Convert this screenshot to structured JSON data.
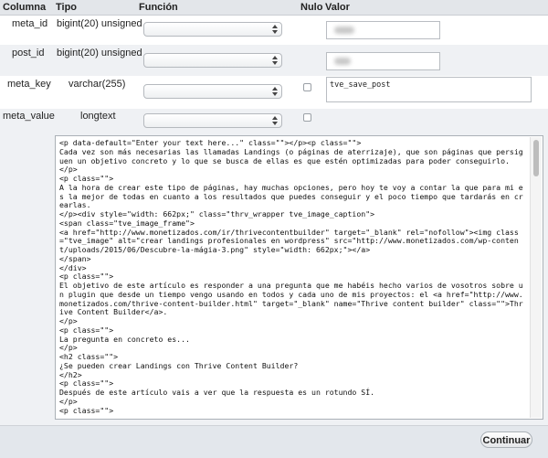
{
  "header": {
    "columna": "Columna",
    "tipo": "Tipo",
    "funcion": "Función",
    "nulo": "Nulo",
    "valor": "Valor"
  },
  "rows": [
    {
      "name": "meta_id",
      "type": "bigint(20) unsigned",
      "value": ""
    },
    {
      "name": "post_id",
      "type": "bigint(20) unsigned",
      "value": ""
    },
    {
      "name": "meta_key",
      "type": "varchar(255)",
      "value": "tve_save_post"
    },
    {
      "name": "meta_value",
      "type": "longtext",
      "value": "<p data-default=\"Enter your text here...\" class=\"\"></p><p class=\"\">\nCada vez son más necesarias las llamadas Landings (o páginas de aterrizaje), que son páginas que persiguen un objetivo concreto y lo que se busca de ellas es que estén optimizadas para poder conseguirlo.\n</p>\n<p class=\"\">\nA la hora de crear este tipo de páginas, hay muchas opciones, pero hoy te voy a contar la que para mi es la mejor de todas en cuanto a los resultados que puedes conseguir y el poco tiempo que tardarás en crearlas.\n</p><div style=\"width: 662px;\" class=\"thrv_wrapper tve_image_caption\">\n<span class=\"tve_image_frame\">\n<a href=\"http://www.monetizados.com/ir/thrivecontentbuilder\" target=\"_blank\" rel=\"nofollow\"><img class=\"tve_image\" alt=\"crear landings profesionales en wordpress\" src=\"http://www.monetizados.com/wp-content/uploads/2015/06/Descubre-la-mágia-3.png\" style=\"width: 662px;\"></a>\n</span>\n</div>\n<p class=\"\">\nEl objetivo de este artículo es responder a una pregunta que me habéis hecho varios de vosotros sobre un plugin que desde un tiempo vengo usando en todos y cada uno de mis proyectos: el <a href=\"http://www.monetizados.com/thrive-content-builder.html\" target=\"_blank\" name=\"Thrive content builder\" class=\"\">Thrive Content Builder</a>.\n</p>\n<p class=\"\">\nLa pregunta en concreto es...\n</p>\n<h2 class=\"\">\n¿Se pueden crear Landings con Thrive Content Builder?\n</h2>\n<p class=\"\">\nDespués de este artículo vais a ver que la respuesta es un rotundo SÍ.\n</p>\n<p class=\"\">"
    }
  ],
  "footer": {
    "button_label": "Continuar"
  }
}
